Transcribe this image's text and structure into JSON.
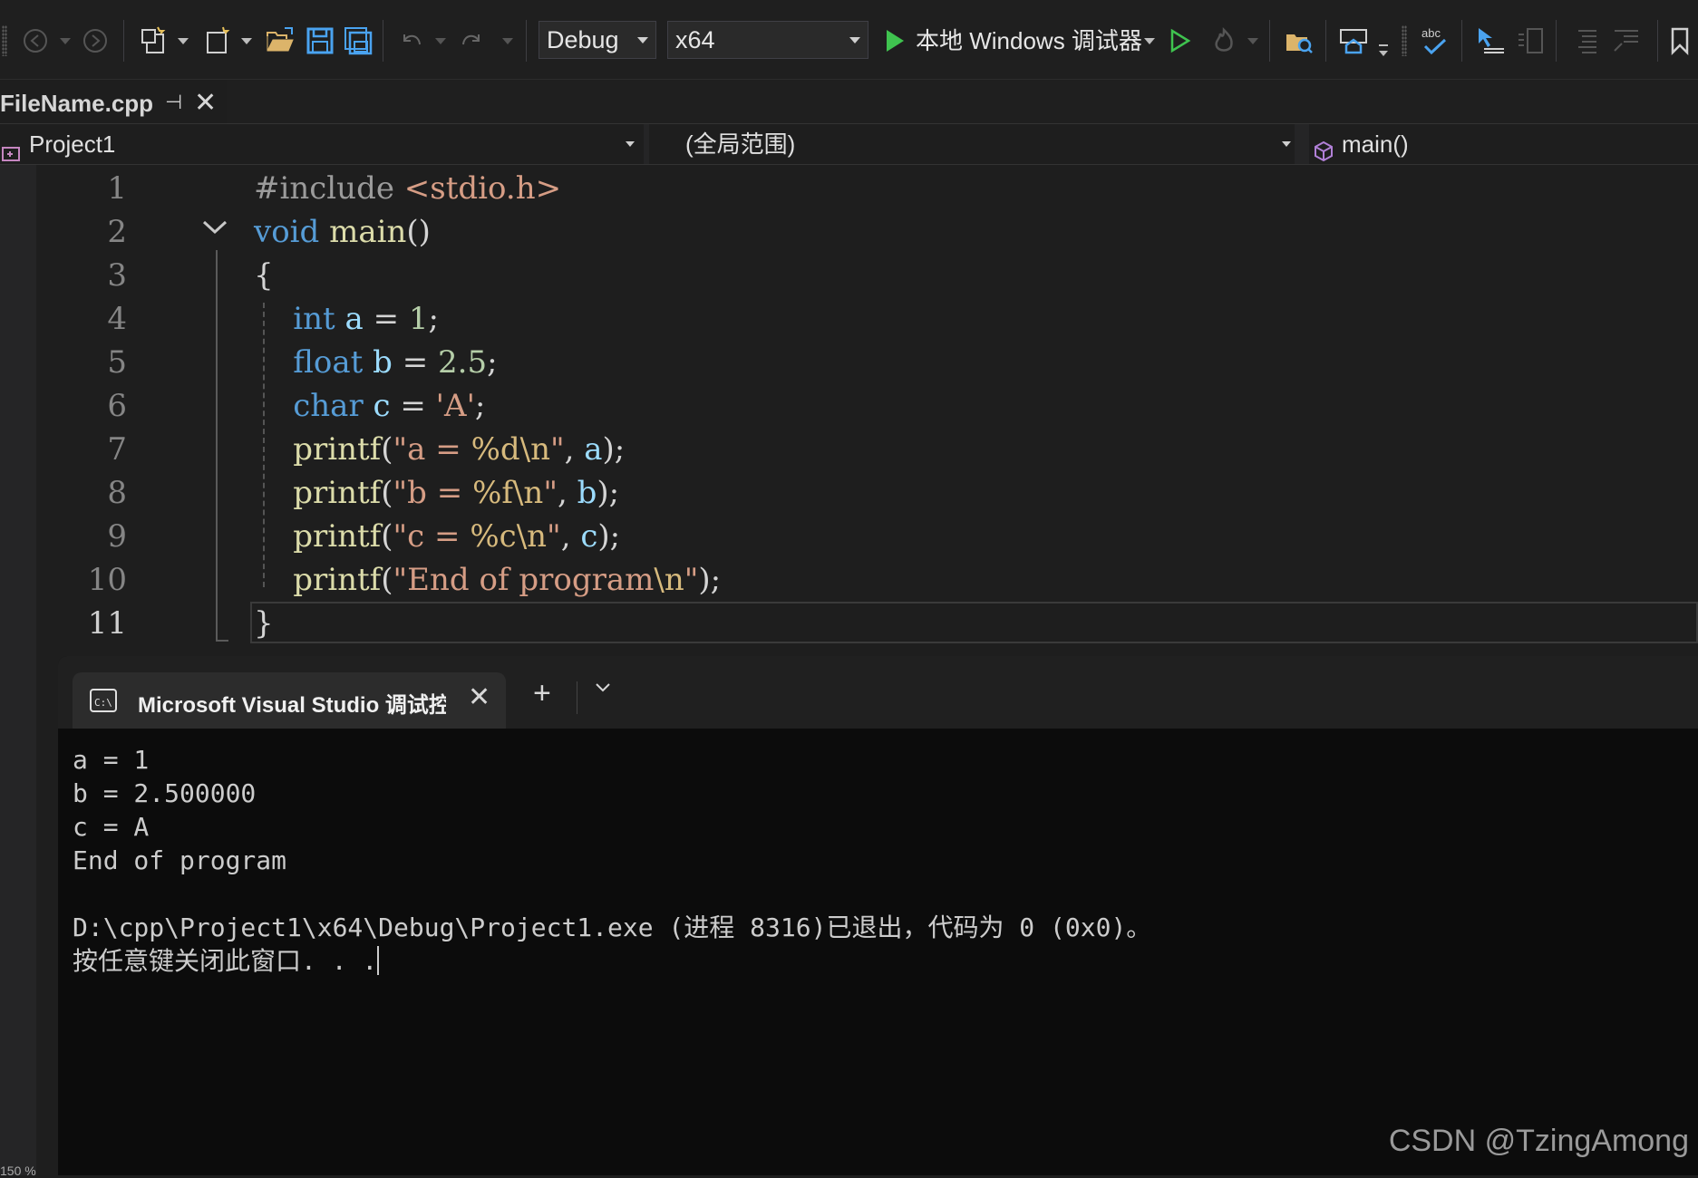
{
  "toolbar": {
    "config": "Debug",
    "platform": "x64",
    "debugger_label": "本地 Windows 调试器"
  },
  "tab": {
    "file_name": "FileName.cpp"
  },
  "navbar": {
    "project": "Project1",
    "scope": "(全局范围)",
    "member": "main()"
  },
  "editor": {
    "line_numbers": [
      "1",
      "2",
      "3",
      "4",
      "5",
      "6",
      "7",
      "8",
      "9",
      "10",
      "11"
    ],
    "lines": [
      [
        {
          "t": "#include ",
          "c": "pre"
        },
        {
          "t": "<stdio.h>",
          "c": "str"
        }
      ],
      [
        {
          "t": "void ",
          "c": "kw"
        },
        {
          "t": "main",
          "c": "fn"
        },
        {
          "t": "()",
          "c": ""
        }
      ],
      [
        {
          "t": "{",
          "c": ""
        }
      ],
      [
        {
          "t": "    int ",
          "c": "kw"
        },
        {
          "t": "a",
          "c": "var"
        },
        {
          "t": " = ",
          "c": ""
        },
        {
          "t": "1",
          "c": "num"
        },
        {
          "t": ";",
          "c": ""
        }
      ],
      [
        {
          "t": "    float ",
          "c": "kw"
        },
        {
          "t": "b",
          "c": "var"
        },
        {
          "t": " = ",
          "c": ""
        },
        {
          "t": "2.5",
          "c": "num"
        },
        {
          "t": ";",
          "c": ""
        }
      ],
      [
        {
          "t": "    char ",
          "c": "kw"
        },
        {
          "t": "c",
          "c": "var"
        },
        {
          "t": " = ",
          "c": ""
        },
        {
          "t": "'A'",
          "c": "str"
        },
        {
          "t": ";",
          "c": ""
        }
      ],
      [
        {
          "t": "    printf",
          "c": "fn"
        },
        {
          "t": "(",
          "c": ""
        },
        {
          "t": "\"a = ",
          "c": "str"
        },
        {
          "t": "%d\\n",
          "c": "esc"
        },
        {
          "t": "\"",
          "c": "str"
        },
        {
          "t": ", ",
          "c": ""
        },
        {
          "t": "a",
          "c": "var"
        },
        {
          "t": ");",
          "c": ""
        }
      ],
      [
        {
          "t": "    printf",
          "c": "fn"
        },
        {
          "t": "(",
          "c": ""
        },
        {
          "t": "\"b = ",
          "c": "str"
        },
        {
          "t": "%f\\n",
          "c": "esc"
        },
        {
          "t": "\"",
          "c": "str"
        },
        {
          "t": ", ",
          "c": ""
        },
        {
          "t": "b",
          "c": "var"
        },
        {
          "t": ");",
          "c": ""
        }
      ],
      [
        {
          "t": "    printf",
          "c": "fn"
        },
        {
          "t": "(",
          "c": ""
        },
        {
          "t": "\"c = ",
          "c": "str"
        },
        {
          "t": "%c\\n",
          "c": "esc"
        },
        {
          "t": "\"",
          "c": "str"
        },
        {
          "t": ", ",
          "c": ""
        },
        {
          "t": "c",
          "c": "var"
        },
        {
          "t": ");",
          "c": ""
        }
      ],
      [
        {
          "t": "    printf",
          "c": "fn"
        },
        {
          "t": "(",
          "c": ""
        },
        {
          "t": "\"End of program",
          "c": "str"
        },
        {
          "t": "\\n",
          "c": "esc"
        },
        {
          "t": "\"",
          "c": "str"
        },
        {
          "t": ");",
          "c": ""
        }
      ],
      [
        {
          "t": "}",
          "c": ""
        }
      ]
    ]
  },
  "terminal": {
    "tab_title": "Microsoft Visual Studio 调试控制台",
    "output_lines": [
      "a = 1",
      "b = 2.500000",
      "c = A",
      "End of program",
      "",
      "D:\\cpp\\Project1\\x64\\Debug\\Project1.exe (进程 8316)已退出，代码为 0 (0x0)。",
      "按任意键关闭此窗口. . ."
    ]
  },
  "watermark": "CSDN @TzingAmong",
  "zoom": "150 %"
}
